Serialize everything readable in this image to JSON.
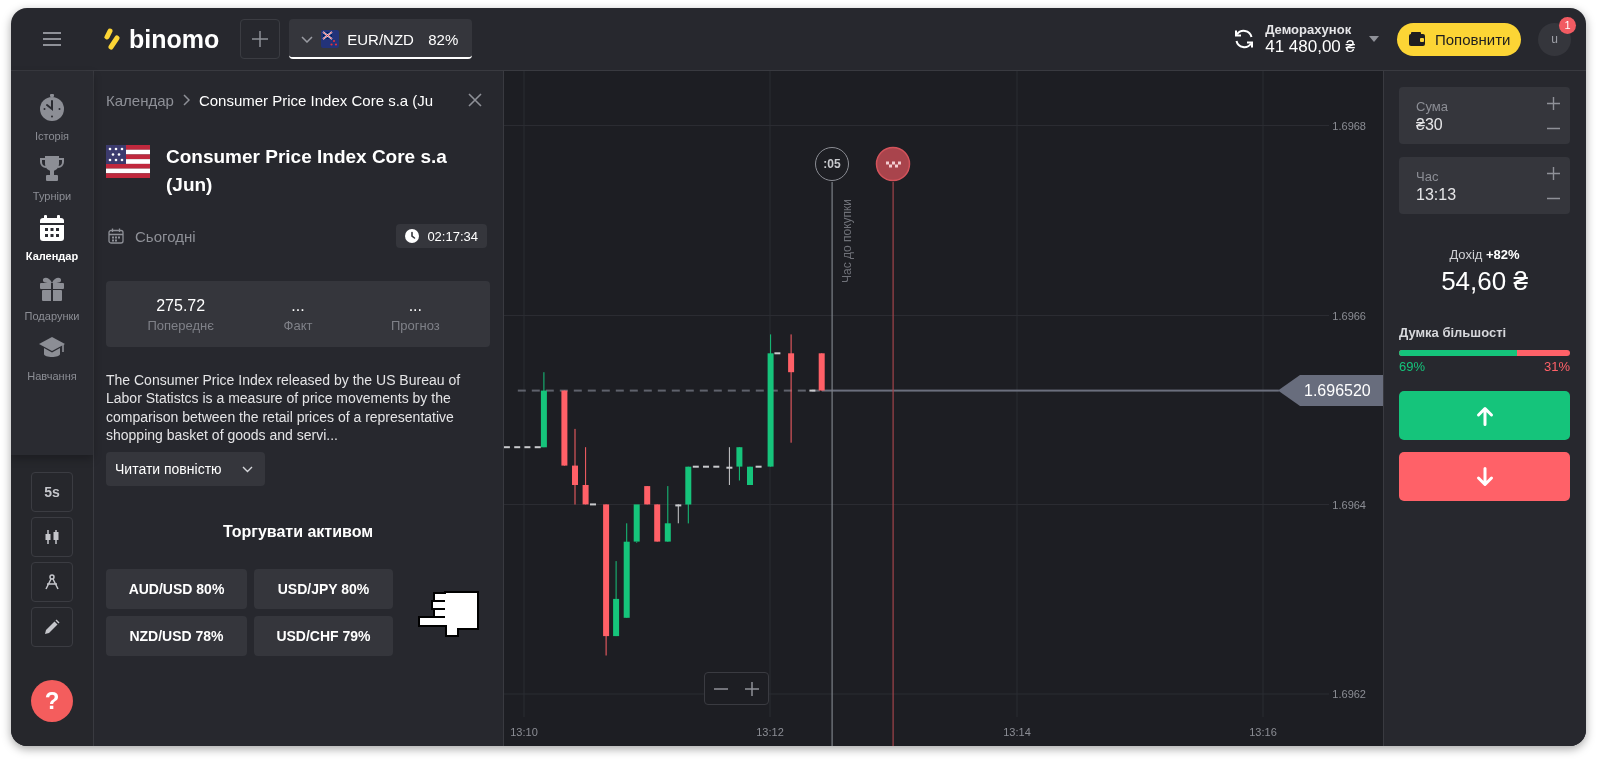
{
  "top_bar": {
    "logo": "binomo",
    "asset_tab": {
      "pair": "EUR/NZD",
      "payout": "82%",
      "selected": true
    },
    "account": {
      "label": "Деморахунок",
      "balance": "41 480,00 ₴"
    },
    "deposit_button": "Поповнити",
    "avatar": {
      "initial": "u",
      "badge": "1"
    }
  },
  "nav": {
    "items": [
      {
        "label": "Історія",
        "selected": false
      },
      {
        "label": "Турніри",
        "selected": false
      },
      {
        "label": "Календар",
        "selected": true
      },
      {
        "label": "Подарунки",
        "selected": false
      },
      {
        "label": "Навчання",
        "selected": false
      }
    ]
  },
  "tools": {
    "interval": "5s"
  },
  "help_button": "?",
  "event_panel": {
    "breadcrumb": {
      "parent": "Календар",
      "current": "Consumer Price Index Core s.a (Ju"
    },
    "title": "Consumer Price Index Core s.a (Jun)",
    "date": "Сьогодні",
    "countdown": "02:17:34",
    "stats": [
      {
        "value": "275.72",
        "label": "Попереднє"
      },
      {
        "value": "...",
        "label": "Факт"
      },
      {
        "value": "...",
        "label": "Прогноз"
      }
    ],
    "description": "The Consumer Price Index released by the US Bureau of Labor Statistcs is a measure of price movements by the comparison between the retail prices of a representative shopping basket of goods and servi...",
    "read_more": "Читати повністю",
    "trade_heading": "Торгувати активом",
    "assets": [
      "AUD/USD 80%",
      "USD/JPY 80%",
      "NZD/USD 78%",
      "USD/CHF 79%"
    ]
  },
  "chart": {
    "y_labels": [
      "1.6968",
      "1.6966",
      "1.6964",
      "1.6962"
    ],
    "x_labels": [
      "13:10",
      "13:12",
      "13:14",
      "13:16"
    ],
    "timer": ":05",
    "timer_caption": "Час до покупки",
    "current_price": "1.696520"
  },
  "trade_panel": {
    "amount": {
      "label": "Сума",
      "value": "₴30"
    },
    "time": {
      "label": "Час",
      "value": "13:13"
    },
    "payout": "Дохід **+82%**",
    "profit": "54,60 ₴",
    "sentiment": {
      "title": "Думка більшості",
      "level": 0.69,
      "up_percent": "69%",
      "down_percent": "31%"
    }
  }
}
